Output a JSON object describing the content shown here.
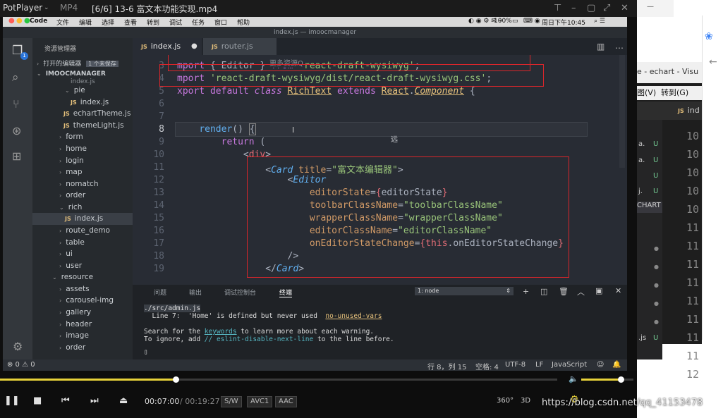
{
  "player": {
    "app_name": "PotPlayer",
    "format": "MP4",
    "file_title": "[6/6] 13-6 富文本功能实现.mp4",
    "time_current": "00:07:00",
    "time_total": "/ 00:19:27",
    "badges": [
      "S/W",
      "AVC1",
      "AAC"
    ],
    "extra_labels": [
      "360°",
      "3D"
    ],
    "progress_fraction": 0.315,
    "volume_fraction": 0.75
  },
  "mac_menu": {
    "app": "Code",
    "items": [
      "文件",
      "编辑",
      "选择",
      "查看",
      "转到",
      "调试",
      "任务",
      "窗口",
      "帮助"
    ],
    "battery": "100%",
    "clock": "周日下午10:45"
  },
  "vscode": {
    "window_title": "index.js — imoocmanager",
    "explorer_title": "资源管理器",
    "open_editors": "打开的编辑器",
    "unsaved_badge": "1 个未保存",
    "project": "IMOOCMANAGER",
    "tree": [
      {
        "label": "index.js",
        "type": "file"
      },
      {
        "label": "pie",
        "type": "folder-open"
      },
      {
        "label": "index.js",
        "type": "file"
      },
      {
        "label": "echartTheme.js",
        "type": "file"
      },
      {
        "label": "themeLight.js",
        "type": "file"
      },
      {
        "label": "form",
        "type": "folder"
      },
      {
        "label": "home",
        "type": "folder"
      },
      {
        "label": "login",
        "type": "folder"
      },
      {
        "label": "map",
        "type": "folder"
      },
      {
        "label": "nomatch",
        "type": "folder"
      },
      {
        "label": "order",
        "type": "folder"
      },
      {
        "label": "rich",
        "type": "folder-open"
      },
      {
        "label": "index.js",
        "type": "file"
      },
      {
        "label": "route_demo",
        "type": "folder"
      },
      {
        "label": "table",
        "type": "folder"
      },
      {
        "label": "ui",
        "type": "folder"
      },
      {
        "label": "user",
        "type": "folder"
      },
      {
        "label": "resource",
        "type": "folder-open"
      },
      {
        "label": "assets",
        "type": "folder"
      },
      {
        "label": "carousel-img",
        "type": "folder"
      },
      {
        "label": "gallery",
        "type": "folder"
      },
      {
        "label": "header",
        "type": "folder"
      },
      {
        "label": "image",
        "type": "folder"
      },
      {
        "label": "order",
        "type": "folder"
      }
    ],
    "tabs": [
      {
        "label": "index.js",
        "active": true
      },
      {
        "label": "router.js",
        "active": false
      }
    ],
    "overlay_hint": "更多资源Q",
    "cursor_char": "远",
    "code_lines": {
      "l3": "3",
      "l4": "4",
      "l5": "5",
      "l6": "6",
      "l7": "7",
      "l8": "8",
      "l9": "9",
      "l10": "10",
      "l11": "11",
      "l12": "12",
      "l13": "13",
      "l14": "14",
      "l15": "15",
      "l16": "16",
      "l17": "17",
      "l18": "18",
      "l19": "19"
    },
    "panel_tabs": [
      "问题",
      "输出",
      "调试控制台",
      "终端"
    ],
    "terminal_select": "1: node",
    "terminal_lines": {
      "file": "./src/admin.js",
      "warn_prefix": "  Line 7:  'Home' is defined but never used  ",
      "warn_rule": "no-unused-vars",
      "search_pre": "Search for the ",
      "search_kw": "keywords",
      "search_post": " to learn more about each warning.",
      "ignore_pre": "To ignore, add ",
      "ignore_kw": "// eslint-disable-next-line",
      "ignore_post": " to the line before.",
      "prompt": "▯"
    },
    "status": {
      "errors": "⊗ 0 ⚠ 0",
      "position": "行 8，列 15",
      "spaces": "空格: 4",
      "encoding": "UTF-8",
      "eol": "LF",
      "language": "JavaScript"
    }
  },
  "background_app": {
    "title_fragment": "e - echart - Visu",
    "menu_view": "图(V)",
    "menu_goto": "转到(G)",
    "tab_label": "ind",
    "chart_label": "CHART",
    "line_numbers": [
      "10",
      "10",
      "10",
      "10",
      "10",
      "11",
      "11",
      "11",
      "11",
      "11",
      "11",
      "11",
      "11",
      "12"
    ],
    "letters": [
      "U",
      "U",
      "U",
      "U",
      "U"
    ],
    "file_frags": [
      "a.",
      "a.",
      "j.",
      ".js"
    ]
  },
  "watermark": "https://blog.csdn.net/qq_41153478"
}
